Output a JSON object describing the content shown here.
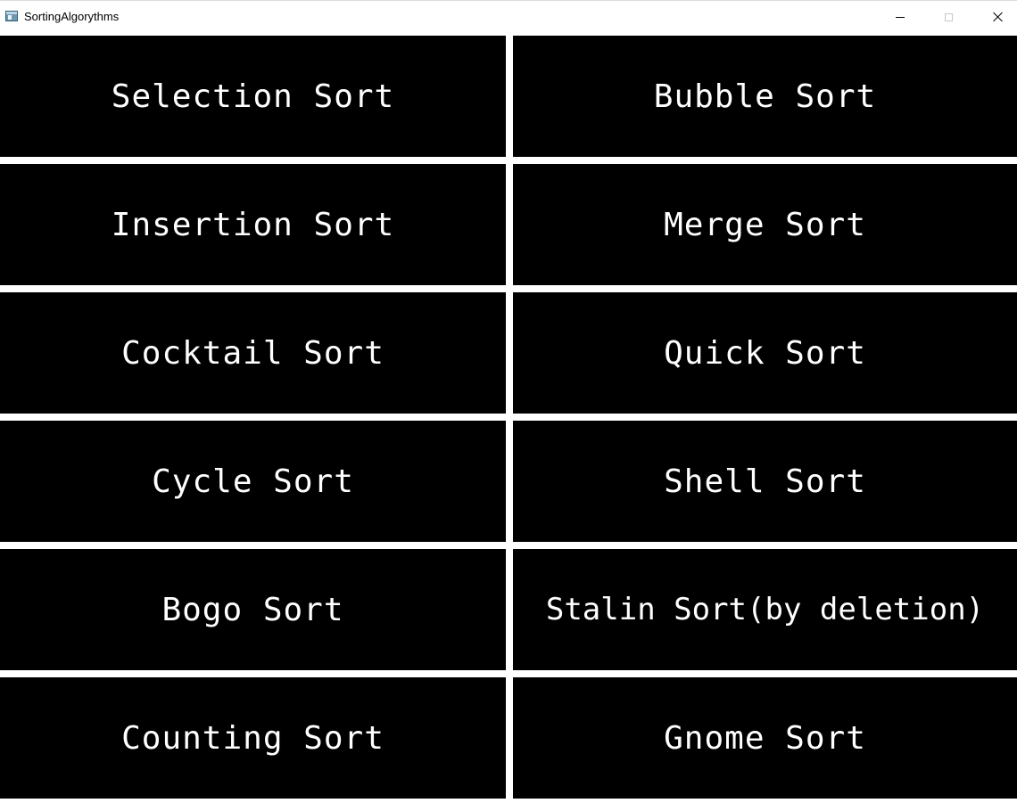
{
  "window": {
    "title": "SortingAlgorythms",
    "icon": "app-window-icon",
    "controls": {
      "minimize": "minimize-icon",
      "maximize": "maximize-icon",
      "close": "close-icon"
    }
  },
  "colors": {
    "tile_background": "#000000",
    "tile_text": "#ffffff",
    "separator": "#ffffff"
  },
  "buttons": [
    {
      "label": "Selection Sort"
    },
    {
      "label": "Bubble Sort"
    },
    {
      "label": "Insertion Sort"
    },
    {
      "label": "Merge Sort"
    },
    {
      "label": "Cocktail Sort"
    },
    {
      "label": "Quick Sort"
    },
    {
      "label": "Cycle Sort"
    },
    {
      "label": "Shell Sort"
    },
    {
      "label": "Bogo Sort"
    },
    {
      "label": "Stalin Sort(by deletion)"
    },
    {
      "label": "Counting Sort"
    },
    {
      "label": "Gnome Sort"
    }
  ]
}
